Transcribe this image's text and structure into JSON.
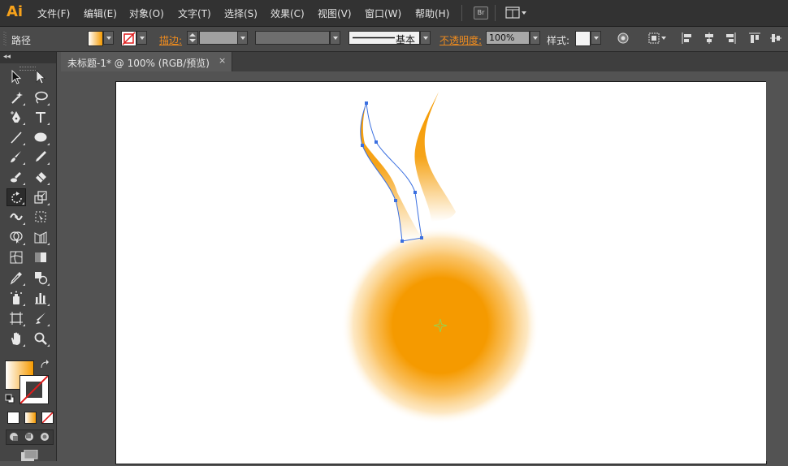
{
  "app": {
    "logo": "Ai"
  },
  "menu": [
    {
      "key": "file",
      "label": "文件(F)"
    },
    {
      "key": "edit",
      "label": "编辑(E)"
    },
    {
      "key": "object",
      "label": "对象(O)"
    },
    {
      "key": "type",
      "label": "文字(T)"
    },
    {
      "key": "select",
      "label": "选择(S)"
    },
    {
      "key": "effect",
      "label": "效果(C)"
    },
    {
      "key": "view",
      "label": "视图(V)"
    },
    {
      "key": "window",
      "label": "窗口(W)"
    },
    {
      "key": "help",
      "label": "帮助(H)"
    }
  ],
  "bridge_button": "Br",
  "control_bar": {
    "selection_type": "路径",
    "stroke_label": "描边:",
    "stroke_profile": "基本",
    "opacity_label": "不透明度:",
    "opacity_value": "100%",
    "style_label": "样式:"
  },
  "document_tab": {
    "title": "未标题-1* @ 100% (RGB/预览)",
    "close": "×"
  },
  "colors": {
    "accent_orange": "#f7a21b",
    "fill_gradient_start": "#ffffff",
    "fill_gradient_end": "#f59a00",
    "sun_core": "#f59a00",
    "selection_blue": "#3a6fe0"
  },
  "toolbox_icons": [
    "selection-icon",
    "direct-selection-icon",
    "magic-wand-icon",
    "lasso-icon",
    "pen-icon",
    "type-icon",
    "line-segment-icon",
    "ellipse-icon",
    "paintbrush-icon",
    "pencil-icon",
    "blob-brush-icon",
    "eraser-icon",
    "rotate-icon",
    "scale-icon",
    "width-icon",
    "free-transform-icon",
    "shape-builder-icon",
    "perspective-grid-icon",
    "mesh-icon",
    "gradient-icon",
    "eyedropper-icon",
    "blend-icon",
    "symbol-sprayer-icon",
    "column-graph-icon",
    "artboard-icon",
    "slice-icon",
    "hand-icon",
    "zoom-icon"
  ]
}
